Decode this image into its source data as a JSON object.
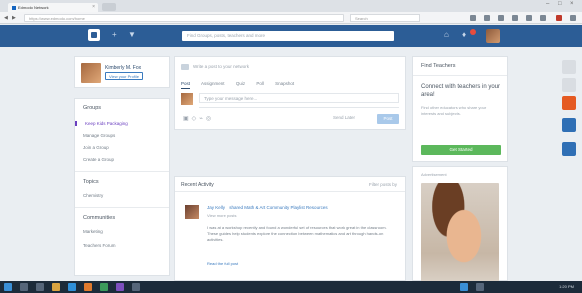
{
  "browser": {
    "tab_title": "Edmodo Network",
    "url": "https://www.edmodo.com/home",
    "search_placeholder": "Search"
  },
  "app": {
    "search_placeholder": "Find Groups, posts, teachers and more",
    "colors": {
      "header": "#2c5d96",
      "accent": "#6a3fbf",
      "green": "#5cb85c",
      "link": "#3b7bbf"
    }
  },
  "profile": {
    "name": "Kimberly M. Fox",
    "view_button": "View your Profile"
  },
  "left_nav": {
    "groups_title": "Groups",
    "groups": [
      "Keep Kids Packaging",
      "Manage Groups",
      "Join a Group",
      "Create a Group"
    ],
    "topics_title": "Topics",
    "topics": [
      "Chemistry"
    ],
    "communities_title": "Communities",
    "communities": [
      "Marketing",
      "Teachers Forum"
    ]
  },
  "composer": {
    "header": "Write a post to your network",
    "tabs": [
      "Post",
      "Assignment",
      "Quiz",
      "Poll",
      "Snapshot"
    ],
    "message_placeholder": "Type your message here...",
    "recipient_placeholder": "Send to a group, student, parent, or teacher",
    "send_label": "Send Later",
    "post_label": "Post"
  },
  "feed": {
    "title": "Recent Activity",
    "filter": "Filter posts by",
    "post": {
      "author": "Jay Kelly",
      "meta": "shared Math & Art Community Playlist Resources",
      "sub": "View more posts",
      "body": "I was at a workshop recently and found a wonderful set of resources that work great in the classroom. These guides help students explore the connection between mathematics and art through hands-on activities.",
      "read_more": "Read the full post"
    }
  },
  "right": {
    "card_title": "Find Teachers",
    "connect_title": "Connect with teachers in your area!",
    "connect_body": "Find other educators who share your interests and subjects.",
    "connect_button": "Get Started",
    "promo_label": "Advertisement"
  },
  "taskbar": {
    "time": "1:20 PM"
  }
}
